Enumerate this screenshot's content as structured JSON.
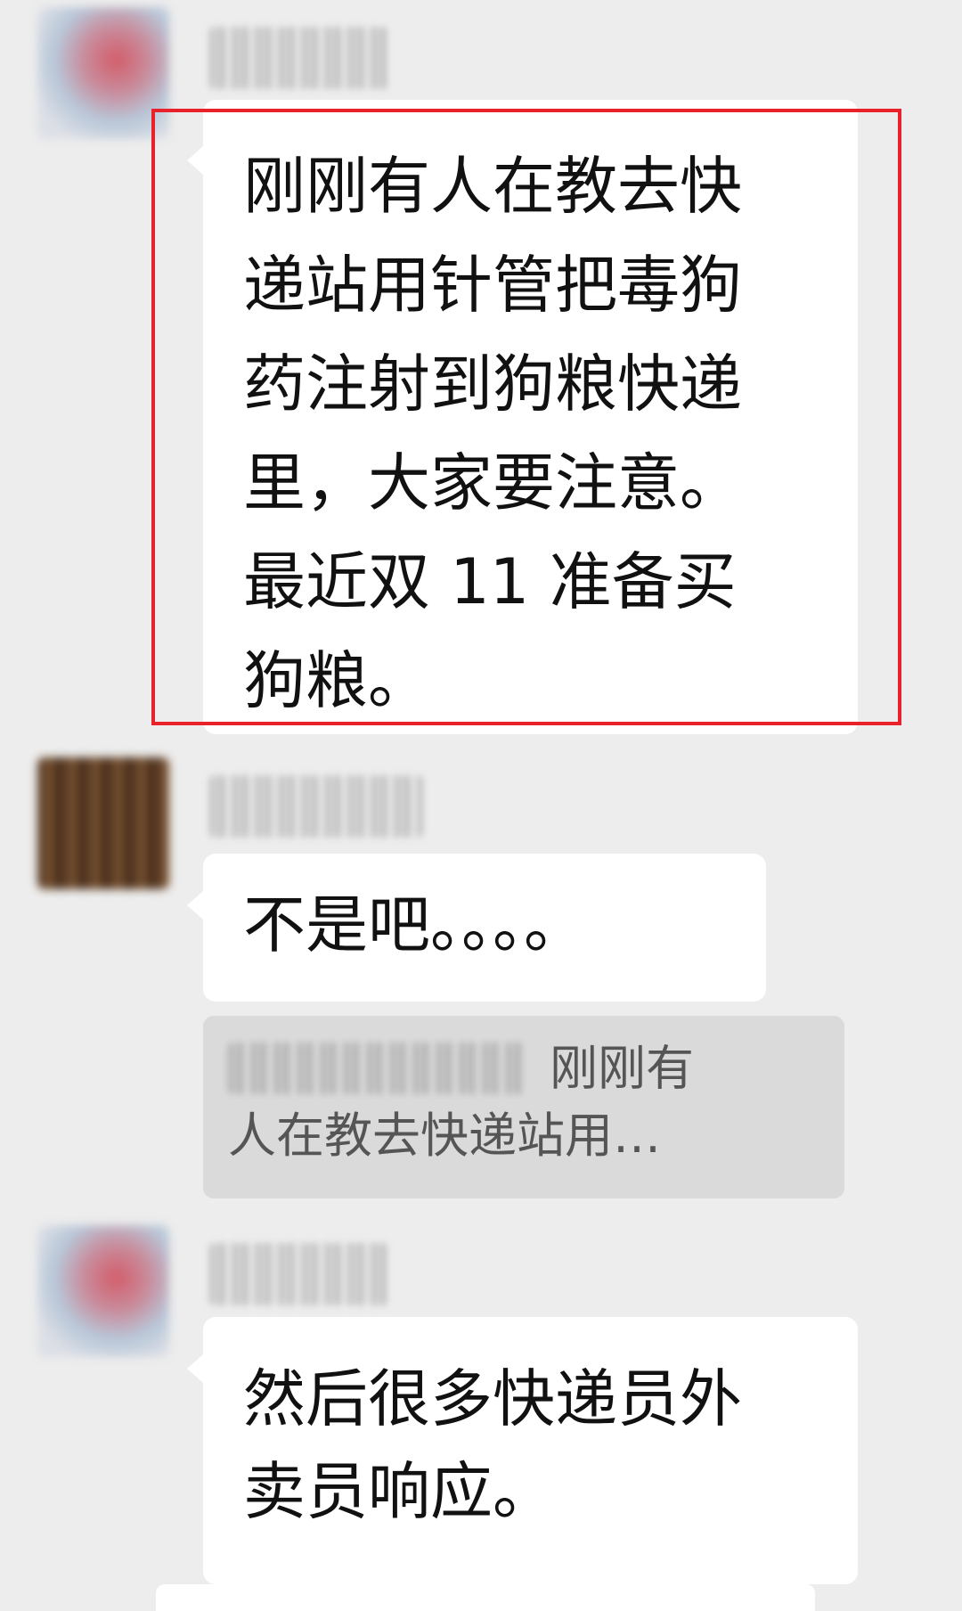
{
  "messages": [
    {
      "sender": "user-a",
      "lines": [
        "刚刚有人在教去快",
        "递站用针管把毒狗",
        "药注射到狗粮快递",
        "里，大家要注意。",
        "最近双 11 准备买",
        "狗粮。"
      ],
      "highlighted": true
    },
    {
      "sender": "user-b",
      "lines": [
        "不是吧。。。。"
      ]
    },
    {
      "quote": {
        "line1": "刚刚有",
        "line2": "人在教去快递站用…"
      }
    },
    {
      "sender": "user-a",
      "lines": [
        "然后很多快递员外",
        "卖员响应。"
      ]
    }
  ],
  "colors": {
    "background": "#ededed",
    "bubble": "#ffffff",
    "highlight_border": "#e8212b",
    "quote_background": "#dadada"
  }
}
